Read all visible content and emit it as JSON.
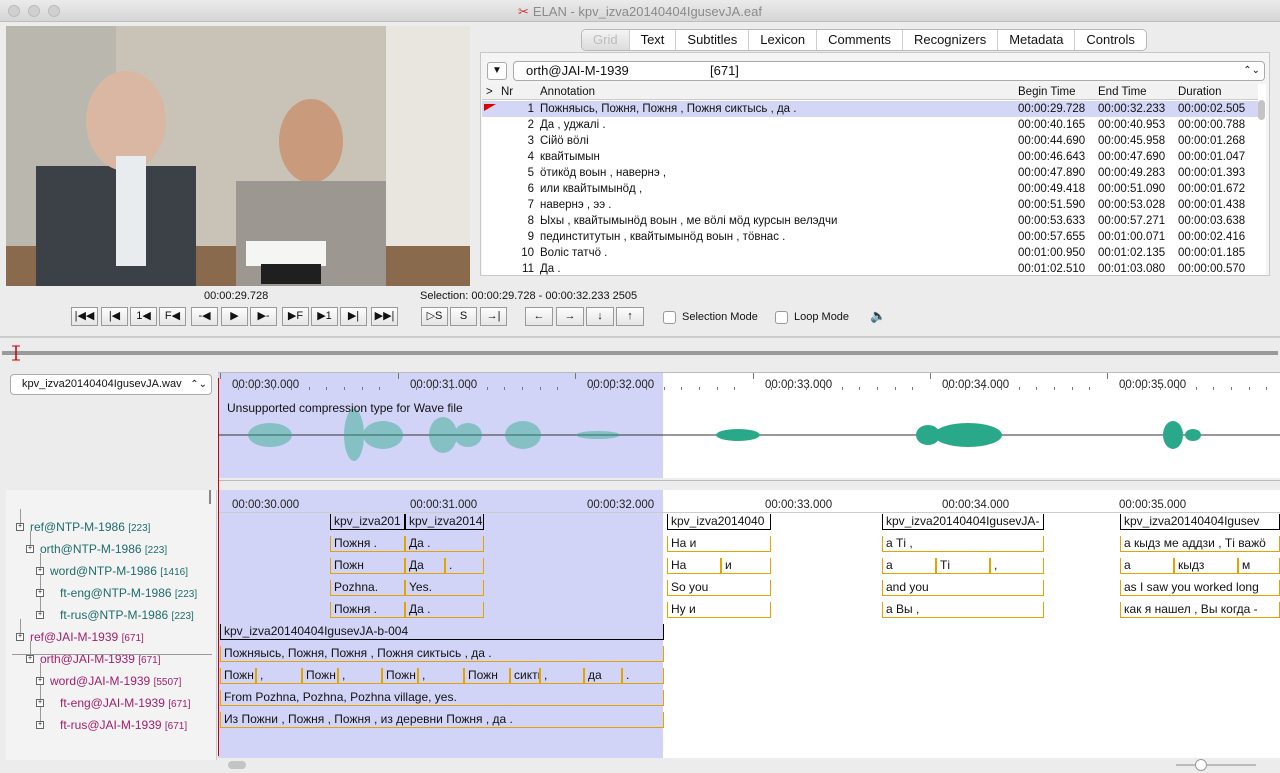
{
  "window": {
    "title": "ELAN - kpv_izva20140404IgusevJA.eaf"
  },
  "tabs": [
    "Grid",
    "Text",
    "Subtitles",
    "Lexicon",
    "Comments",
    "Recognizers",
    "Metadata",
    "Controls"
  ],
  "active_tab": "Grid",
  "grid": {
    "tier_button": "▼",
    "tier_select": "orth@JAI-M-1939",
    "tier_count": "[671]",
    "headers": {
      "arrow": ">",
      "nr": "Nr",
      "annotation": "Annotation",
      "begin": "Begin Time",
      "end": "End Time",
      "duration": "Duration"
    },
    "rows": [
      {
        "nr": "1",
        "text": "Пожняысь, Пожня, Пожня , Пожня сиктысь , да .",
        "begin": "00:00:29.728",
        "end": "00:00:32.233",
        "dur": "00:00:02.505"
      },
      {
        "nr": "2",
        "text": "Да , уджалі .",
        "begin": "00:00:40.165",
        "end": "00:00:40.953",
        "dur": "00:00:00.788"
      },
      {
        "nr": "3",
        "text": "Сійӧ вӧлі",
        "begin": "00:00:44.690",
        "end": "00:00:45.958",
        "dur": "00:00:01.268"
      },
      {
        "nr": "4",
        "text": "квайтымын",
        "begin": "00:00:46.643",
        "end": "00:00:47.690",
        "dur": "00:00:01.047"
      },
      {
        "nr": "5",
        "text": "ӧтикӧд воын , навернэ ,",
        "begin": "00:00:47.890",
        "end": "00:00:49.283",
        "dur": "00:00:01.393"
      },
      {
        "nr": "6",
        "text": "или квайтымынӧд ,",
        "begin": "00:00:49.418",
        "end": "00:00:51.090",
        "dur": "00:00:01.672"
      },
      {
        "nr": "7",
        "text": "навернэ , ээ .",
        "begin": "00:00:51.590",
        "end": "00:00:53.028",
        "dur": "00:00:01.438"
      },
      {
        "nr": "8",
        "text": "Ыхы , квайтымынӧд воын , ме вӧлі мӧд курсын велэдчи",
        "begin": "00:00:53.633",
        "end": "00:00:57.271",
        "dur": "00:00:03.638"
      },
      {
        "nr": "9",
        "text": "пединститутын , квайтымынӧд воын , тӧвнас .",
        "begin": "00:00:57.655",
        "end": "00:01:00.071",
        "dur": "00:00:02.416"
      },
      {
        "nr": "10",
        "text": "Воліс татчӧ .",
        "begin": "00:01:00.950",
        "end": "00:01:02.135",
        "dur": "00:00:01.185"
      },
      {
        "nr": "11",
        "text": "Да .",
        "begin": "00:01:02.510",
        "end": "00:01:03.080",
        "dur": "00:00:00.570"
      }
    ]
  },
  "media": {
    "current_time": "00:00:29.728",
    "selection": "Selection: 00:00:29.728 - 00:00:32.233  2505",
    "buttons": [
      "|◀◀",
      "|◀",
      "1◀",
      "F◀",
      "-◀",
      "▶",
      "▶-",
      "▶F",
      "▶1",
      "▶|",
      "▶▶|",
      "▷S",
      "S",
      "→|",
      "←",
      "→",
      "↓",
      "↑"
    ],
    "selection_mode": "Selection Mode",
    "loop_mode": "Loop Mode",
    "volume_icon": "🔈"
  },
  "waveform": {
    "file": "kpv_izva20140404IgusevJA.wav",
    "message": "Unsupported compression type for Wave file",
    "ticks": [
      "00:00:30.000",
      "00:00:31.000",
      "00:00:32.000",
      "00:00:33.000",
      "00:00:34.000",
      "00:00:35.000"
    ]
  },
  "tiers": [
    {
      "name": "ref@NTP-M-1986",
      "count": "[223]",
      "color": "#1f6b6b"
    },
    {
      "name": "orth@NTP-M-1986",
      "count": "[223]",
      "color": "#1f6b6b"
    },
    {
      "name": "word@NTP-M-1986",
      "count": "[1416]",
      "color": "#1f6b6b"
    },
    {
      "name": "ft-eng@NTP-M-1986",
      "count": "[223]",
      "color": "#1f6b6b"
    },
    {
      "name": "ft-rus@NTP-M-1986",
      "count": "[223]",
      "color": "#1f6b6b"
    },
    {
      "name": "ref@JAI-M-1939",
      "count": "[671]",
      "color": "#a0206b"
    },
    {
      "name": "orth@JAI-M-1939",
      "count": "[671]",
      "color": "#a0206b"
    },
    {
      "name": "word@JAI-M-1939",
      "count": "[5507]",
      "color": "#a0206b"
    },
    {
      "name": "ft-eng@JAI-M-1939",
      "count": "[671]",
      "color": "#a0206b"
    },
    {
      "name": "ft-rus@JAI-M-1939",
      "count": "[671]",
      "color": "#a0206b"
    }
  ],
  "annotations": {
    "ntp_ref": [
      "kpv_izva201",
      "kpv_izva2014",
      "kpv_izva2014040",
      "kpv_izva20140404IgusevJA-",
      "kpv_izva20140404Igusev"
    ],
    "ntp_orth": [
      "Пожня .",
      "Да .",
      "На и",
      "а Ті ,",
      "а кыдз ме аддзи , Ті важӧ"
    ],
    "ntp_word": [
      "Пожн",
      "Да",
      ".",
      "На",
      "и",
      "а",
      "Ті",
      ",",
      "а",
      "кыдз",
      "м"
    ],
    "ntp_eng": [
      "Pozhna.",
      "Yes.",
      "So you",
      "and you",
      "as I saw you worked long"
    ],
    "ntp_rus": [
      "Пожня .",
      "Да .",
      "Ну и",
      "а Вы ,",
      "как я нашел , Вы когда -"
    ],
    "jai_ref": "kpv_izva20140404IgusevJA-b-004",
    "jai_orth": "Пожняысь, Пожня, Пожня , Пожня сиктысь , да .",
    "jai_word": [
      "Пожн",
      ",",
      "Пожн",
      ",",
      "Пожн",
      ",",
      "Пожн",
      "сикты",
      ",",
      "да",
      "."
    ],
    "jai_eng": "From Pozhna, Pozhna, Pozhna village, yes.",
    "jai_rus": "Из Пожни , Пожня , Пожня , из деревни Пожня , да ."
  },
  "colors": {
    "selection": "#d2d4f7",
    "waveform": "#2aa98a",
    "cursor": "#cc0000",
    "ntp": "#1f6b6b",
    "jai": "#a0206b"
  }
}
